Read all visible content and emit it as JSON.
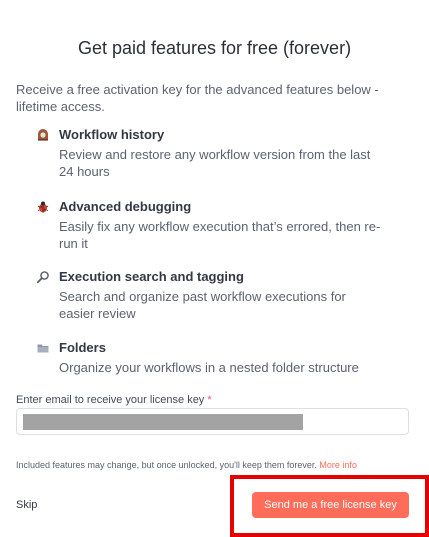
{
  "dialog": {
    "title": "Get paid features for free (forever)",
    "intro": "Receive a free activation key for the advanced features below - lifetime access."
  },
  "features": [
    {
      "icon": "history-icon",
      "title": "Workflow history",
      "description": "Review and restore any workflow version from the last 24 hours"
    },
    {
      "icon": "bug-icon",
      "title": "Advanced debugging",
      "description": "Easily fix any workflow execution that’s errored, then re-run it"
    },
    {
      "icon": "search-icon",
      "title": "Execution search and tagging",
      "description": "Search and organize past workflow executions for easier review"
    },
    {
      "icon": "folder-icon",
      "title": "Folders",
      "description": "Organize your workflows in a nested folder structure"
    }
  ],
  "email": {
    "label": "Enter email to receive your license key",
    "required_mark": "*",
    "value": ""
  },
  "footer": {
    "note": "Included features may change, but once unlocked, you'll keep them forever.",
    "more_info": "More info",
    "skip_label": "Skip",
    "send_label": "Send me a free license key"
  },
  "colors": {
    "accent": "#ff6d5a",
    "required": "#ea4b71",
    "highlight_box": "#e60000"
  }
}
